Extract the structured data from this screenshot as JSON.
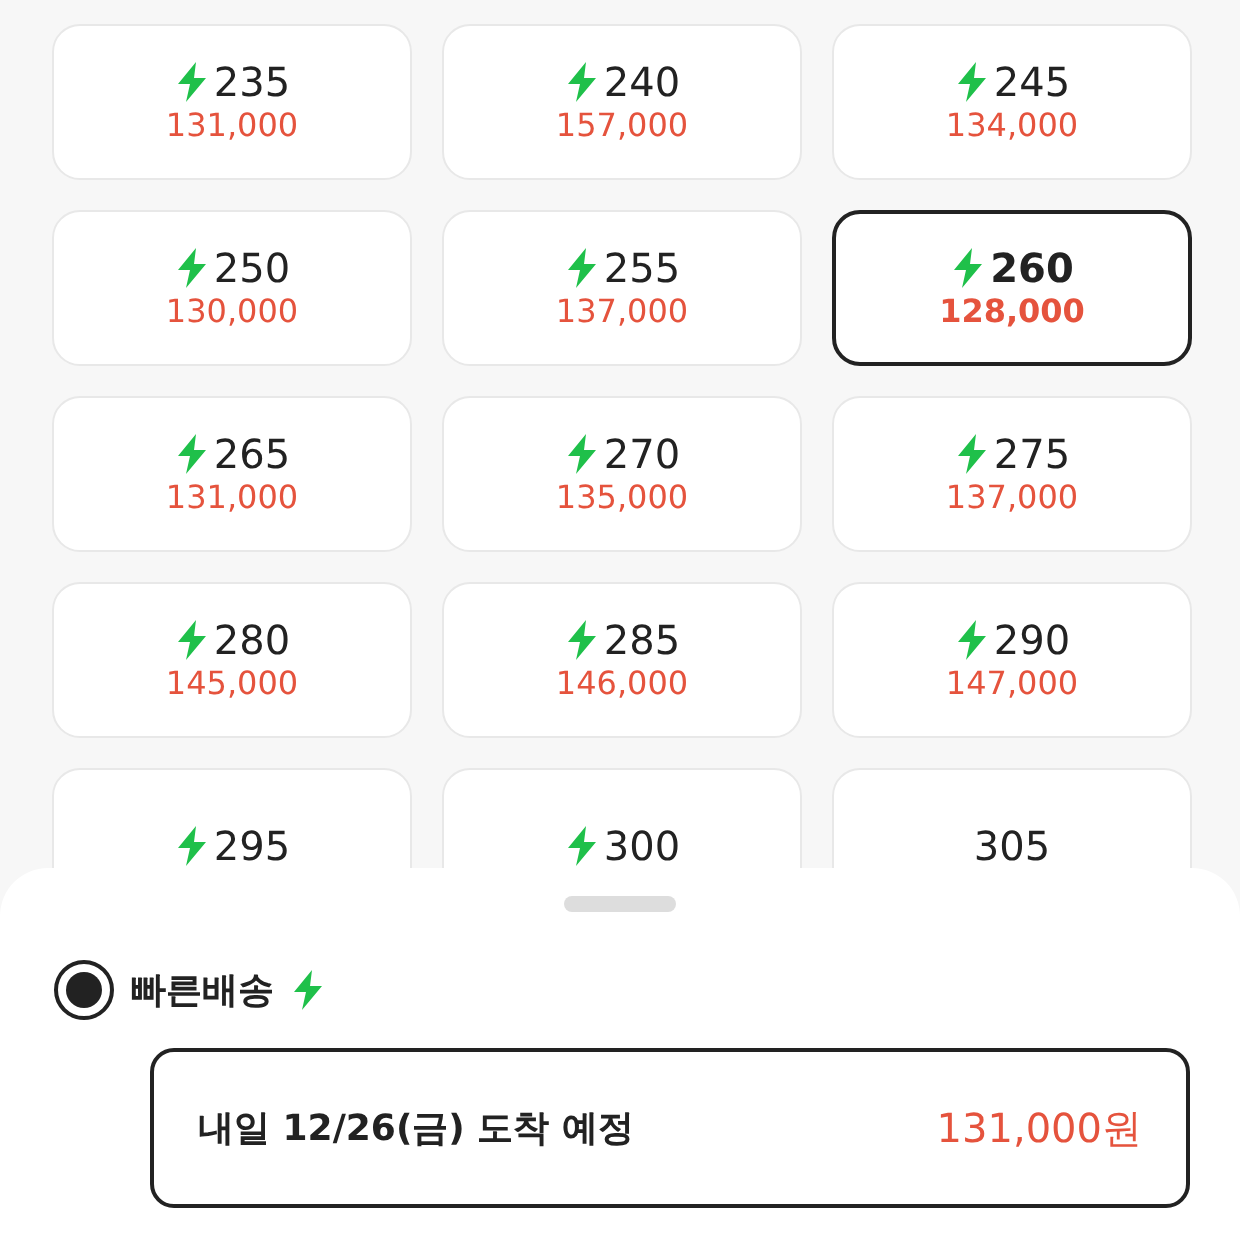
{
  "sizes": [
    {
      "size": "235",
      "price": "131,000",
      "fast": true,
      "selected": false
    },
    {
      "size": "240",
      "price": "157,000",
      "fast": true,
      "selected": false
    },
    {
      "size": "245",
      "price": "134,000",
      "fast": true,
      "selected": false
    },
    {
      "size": "250",
      "price": "130,000",
      "fast": true,
      "selected": false
    },
    {
      "size": "255",
      "price": "137,000",
      "fast": true,
      "selected": false
    },
    {
      "size": "260",
      "price": "128,000",
      "fast": true,
      "selected": true
    },
    {
      "size": "265",
      "price": "131,000",
      "fast": true,
      "selected": false
    },
    {
      "size": "270",
      "price": "135,000",
      "fast": true,
      "selected": false
    },
    {
      "size": "275",
      "price": "137,000",
      "fast": true,
      "selected": false
    },
    {
      "size": "280",
      "price": "145,000",
      "fast": true,
      "selected": false
    },
    {
      "size": "285",
      "price": "146,000",
      "fast": true,
      "selected": false
    },
    {
      "size": "290",
      "price": "147,000",
      "fast": true,
      "selected": false
    },
    {
      "size": "295",
      "fast": true,
      "selected": false
    },
    {
      "size": "300",
      "fast": true,
      "selected": false
    },
    {
      "size": "305",
      "fast": false,
      "selected": false
    }
  ],
  "delivery": {
    "label": "빠른배송",
    "selected": true,
    "fast": true,
    "option": {
      "text": "내일 12/26(금) 도착 예정",
      "price": "131,000원"
    }
  }
}
